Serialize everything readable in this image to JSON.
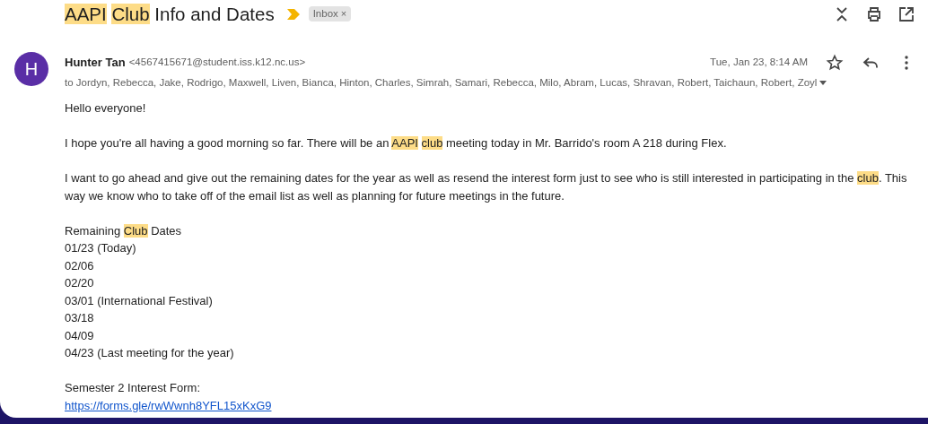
{
  "subject": {
    "segments": [
      {
        "text": "AAPI",
        "highlighted": true
      },
      {
        "text": "Club",
        "highlighted": true,
        "space_before": true
      },
      {
        "text": " Info and Dates",
        "highlighted": false
      }
    ],
    "important": true,
    "label": "Inbox",
    "label_close": "×"
  },
  "message": {
    "avatar_initial": "H",
    "sender_name": "Hunter Tan",
    "sender_email": "<4567415671@student.iss.k12.nc.us>",
    "date": "Tue, Jan 23, 8:14 AM",
    "starred": false,
    "recipients": "to Jordyn, Rebecca, Jake, Rodrigo, Maxwell, Liven, Bianca, Hinton, Charles, Simrah, Samari, Rebecca, Milo, Abram, Lucas, Shravan, Robert, Taichaun, Robert, Zoyl",
    "body": [
      {
        "lines": [
          {
            "kind": "text",
            "segments": [
              {
                "text": "Hello everyone!",
                "highlighted": false
              }
            ]
          }
        ]
      },
      {
        "lines": [
          {
            "kind": "text",
            "segments": [
              {
                "text": "I hope you're all having a good morning so far. There will be an ",
                "highlighted": false
              },
              {
                "text": "AAPI",
                "highlighted": true
              },
              {
                "text": "club",
                "highlighted": true,
                "space_before": true
              },
              {
                "text": " meeting today in Mr. Barrido's room A 218 during Flex.",
                "highlighted": false
              }
            ]
          }
        ]
      },
      {
        "lines": [
          {
            "kind": "text",
            "segments": [
              {
                "text": "I want to go ahead and give out the remaining dates for the year as well as resend the interest form just to see who is still interested in participating in the ",
                "highlighted": false
              },
              {
                "text": "club",
                "highlighted": true
              },
              {
                "text": ". This way we know who to take off of the email list as well as planning for future meetings in the future.",
                "highlighted": false
              }
            ]
          }
        ]
      },
      {
        "lines": [
          {
            "kind": "text",
            "segments": [
              {
                "text": "Remaining ",
                "highlighted": false
              },
              {
                "text": "Club",
                "highlighted": true
              },
              {
                "text": " Dates",
                "highlighted": false
              }
            ]
          },
          {
            "kind": "text",
            "segments": [
              {
                "text": "01/23 (Today)",
                "highlighted": false
              }
            ]
          },
          {
            "kind": "text",
            "segments": [
              {
                "text": "02/06",
                "highlighted": false
              }
            ]
          },
          {
            "kind": "text",
            "segments": [
              {
                "text": "02/20",
                "highlighted": false
              }
            ]
          },
          {
            "kind": "text",
            "segments": [
              {
                "text": "03/01 (International Festival)",
                "highlighted": false
              }
            ]
          },
          {
            "kind": "text",
            "segments": [
              {
                "text": "03/18",
                "highlighted": false
              }
            ]
          },
          {
            "kind": "text",
            "segments": [
              {
                "text": "04/09",
                "highlighted": false
              }
            ]
          },
          {
            "kind": "text",
            "segments": [
              {
                "text": "04/23 (Last meeting for the year)",
                "highlighted": false
              }
            ]
          }
        ]
      },
      {
        "lines": [
          {
            "kind": "text",
            "segments": [
              {
                "text": "Semester 2 Interest Form:",
                "highlighted": false
              }
            ]
          },
          {
            "kind": "link",
            "segments": [
              {
                "text": "https://forms.gle/rwWwnh8YFL15xKxG9",
                "highlighted": false
              }
            ]
          }
        ]
      }
    ]
  }
}
